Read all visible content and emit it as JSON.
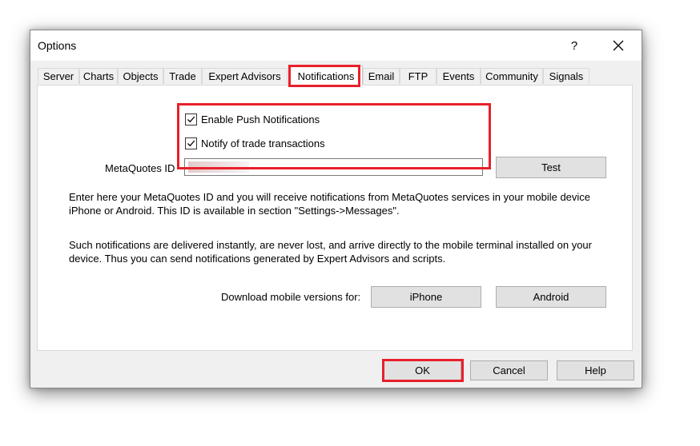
{
  "window": {
    "title": "Options",
    "help_glyph": "?"
  },
  "tabs": [
    {
      "label": "Server"
    },
    {
      "label": "Charts"
    },
    {
      "label": "Objects"
    },
    {
      "label": "Trade"
    },
    {
      "label": "Expert Advisors"
    },
    {
      "label": "Notifications"
    },
    {
      "label": "Email"
    },
    {
      "label": "FTP"
    },
    {
      "label": "Events"
    },
    {
      "label": "Community"
    },
    {
      "label": "Signals"
    }
  ],
  "active_tab": "Notifications",
  "notifications": {
    "enable_push_label": "Enable Push Notifications",
    "enable_push_checked": true,
    "notify_trade_label": "Notify of trade transactions",
    "notify_trade_checked": true,
    "metaquotes_id_label": "MetaQuotes ID",
    "metaquotes_id_value": "",
    "test_button": "Test",
    "info_text_1": "Enter here your MetaQuotes ID and you will receive notifications from MetaQuotes services in your mobile device iPhone or Android. This ID is available in section \"Settings->Messages\".",
    "info_text_2": "Such notifications are delivered instantly, are never lost, and arrive directly to the mobile terminal installed on your device. Thus you can send notifications generated by Expert Advisors and scripts.",
    "download_label": "Download mobile versions for:",
    "iphone_button": "iPhone",
    "android_button": "Android"
  },
  "footer": {
    "ok_button": "OK",
    "cancel_button": "Cancel",
    "help_button": "Help"
  },
  "colors": {
    "highlight": "#e8202a",
    "dialog_bg": "#f0f0f0",
    "button_bg": "#e1e1e1"
  }
}
